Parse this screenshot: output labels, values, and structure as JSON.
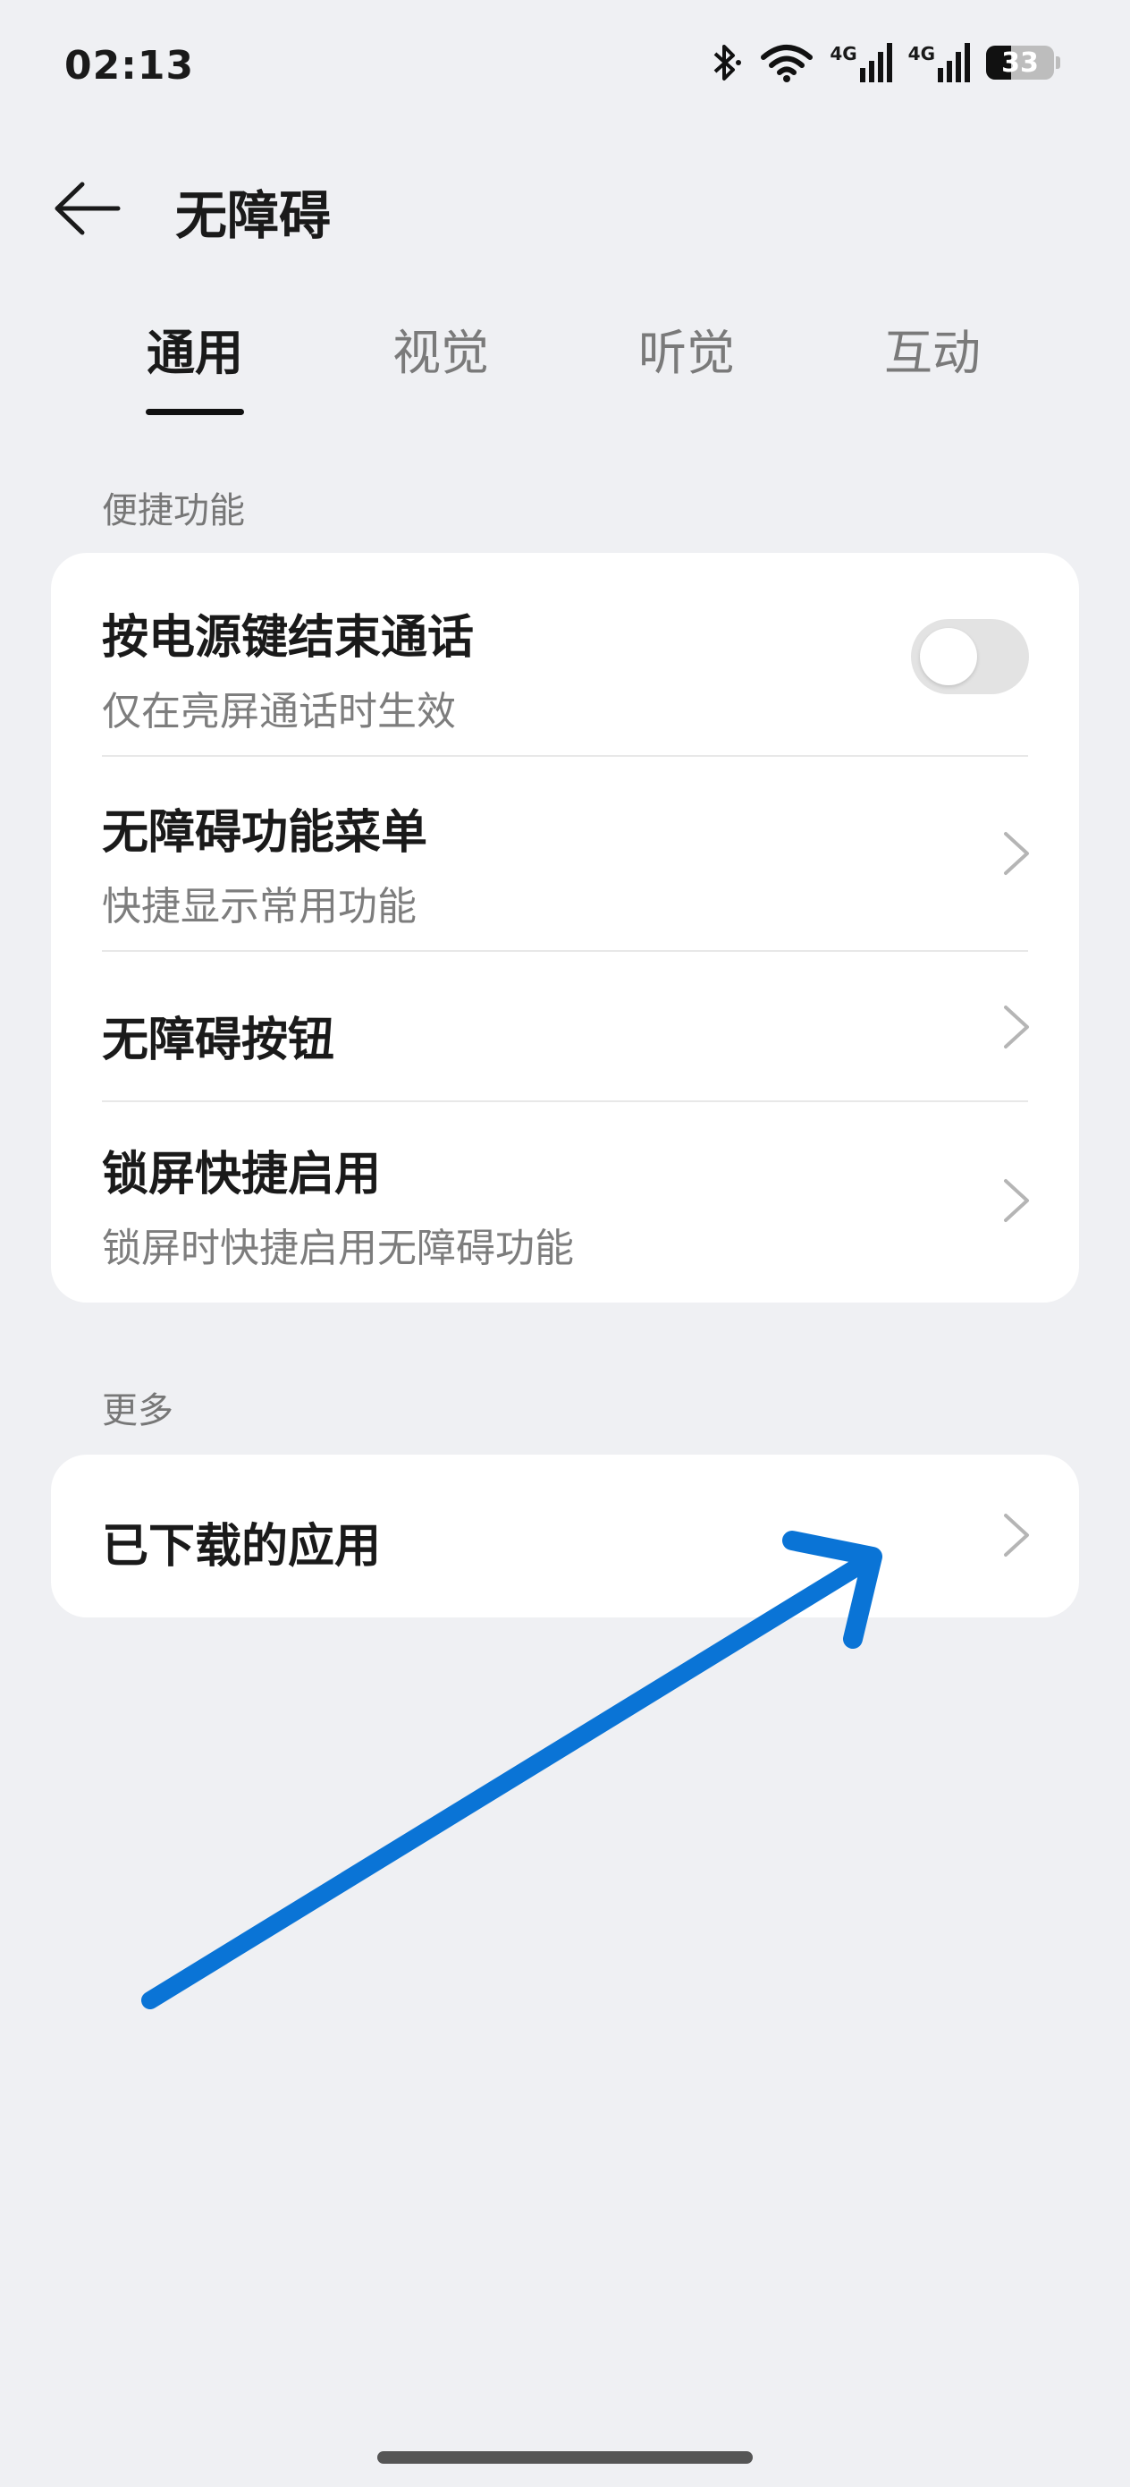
{
  "status_bar": {
    "time": "02:13",
    "network_1": "4G",
    "network_2": "4G",
    "battery": "33"
  },
  "header": {
    "title": "无障碍"
  },
  "tabs": [
    {
      "label": "通用",
      "active": true
    },
    {
      "label": "视觉",
      "active": false
    },
    {
      "label": "听觉",
      "active": false
    },
    {
      "label": "互动",
      "active": false
    }
  ],
  "sections": {
    "shortcuts": {
      "label": "便捷功能",
      "items": [
        {
          "title": "按电源键结束通话",
          "subtitle": "仅在亮屏通话时生效",
          "control": "toggle",
          "toggle_on": false
        },
        {
          "title": "无障碍功能菜单",
          "subtitle": "快捷显示常用功能",
          "control": "chevron"
        },
        {
          "title": "无障碍按钮",
          "subtitle": "",
          "control": "chevron"
        },
        {
          "title": "锁屏快捷启用",
          "subtitle": "锁屏时快捷启用无障碍功能",
          "control": "chevron"
        }
      ]
    },
    "more": {
      "label": "更多",
      "items": [
        {
          "title": "已下载的应用",
          "control": "chevron"
        }
      ]
    }
  },
  "colors": {
    "background": "#eff0f3",
    "card": "#ffffff",
    "annotation_arrow": "#0a74d6",
    "toggle_off": "#e3e3e3"
  }
}
